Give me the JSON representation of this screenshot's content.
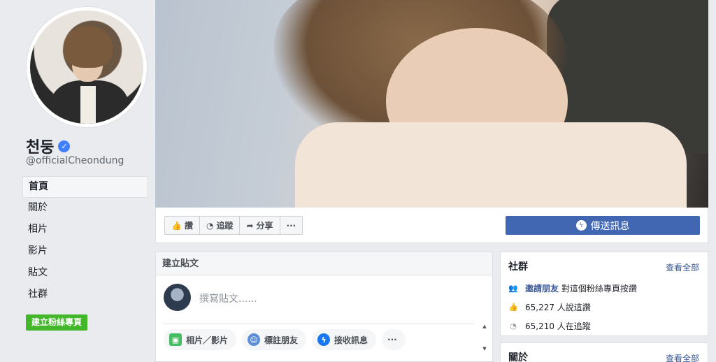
{
  "page": {
    "name": "천둥",
    "handle": "@officialCheondung"
  },
  "nav": {
    "items": [
      "首頁",
      "關於",
      "相片",
      "影片",
      "貼文",
      "社群"
    ],
    "active": "首頁",
    "create_page": "建立粉絲專頁"
  },
  "actions": {
    "like": "讚",
    "follow": "追蹤",
    "share": "分享",
    "more": "···",
    "send_message": "傳送訊息"
  },
  "create_post": {
    "title": "建立貼文",
    "placeholder": "撰寫貼文......",
    "options": [
      "相片／影片",
      "標註朋友",
      "接收訊息"
    ],
    "more": "···"
  },
  "community": {
    "title": "社群",
    "see_all": "查看全部",
    "invite_link": "邀請朋友",
    "invite_text": "對這個粉絲專頁按讚",
    "likes": "65,227 人說這讚",
    "follows": "65,210 人在追蹤"
  },
  "about": {
    "title": "關於",
    "see_all": "查看全部"
  },
  "colors": {
    "brand": "#4267b2",
    "green": "#42b72a",
    "link": "#385898",
    "background": "#e9ebee"
  }
}
